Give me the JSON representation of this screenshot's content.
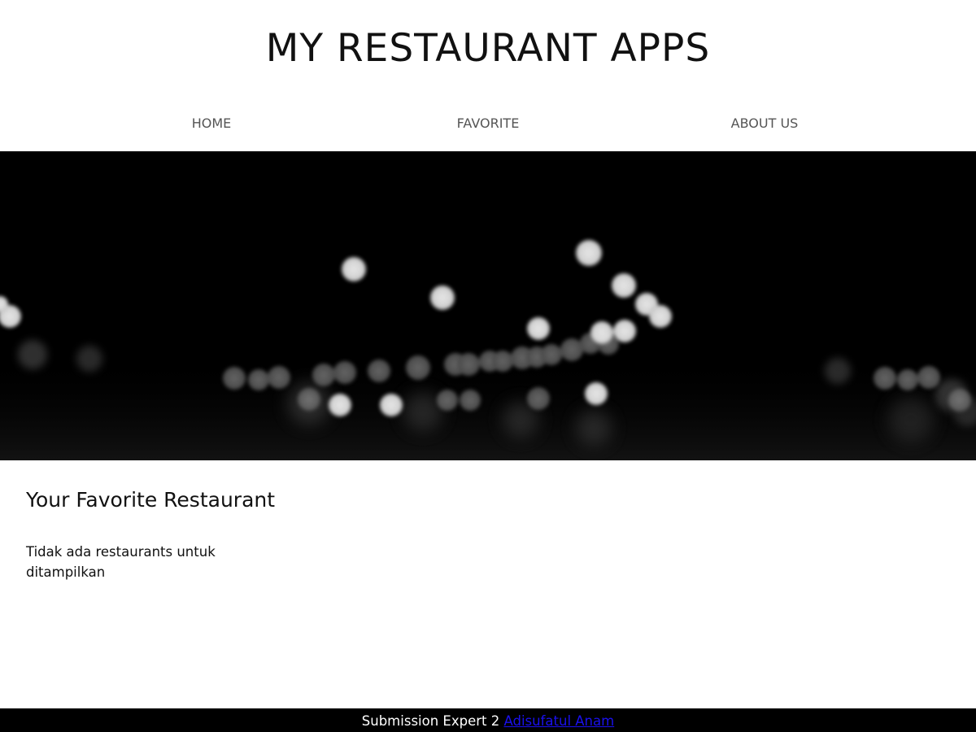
{
  "header": {
    "title": "MY RESTAURANT APPS"
  },
  "nav": {
    "items": [
      {
        "label": "HOME"
      },
      {
        "label": "FAVORITE"
      },
      {
        "label": "ABOUT US"
      }
    ]
  },
  "hero": {
    "image": "bokeh-lights-image",
    "background_color": "#000000"
  },
  "main": {
    "title": "Your Favorite Restaurant",
    "empty_message": "Tidak ada restaurants untuk ditampilkan"
  },
  "footer": {
    "text": "Submission Expert 2",
    "link_label": "Adisufatul Anam",
    "link_color": "#1a10ee"
  }
}
